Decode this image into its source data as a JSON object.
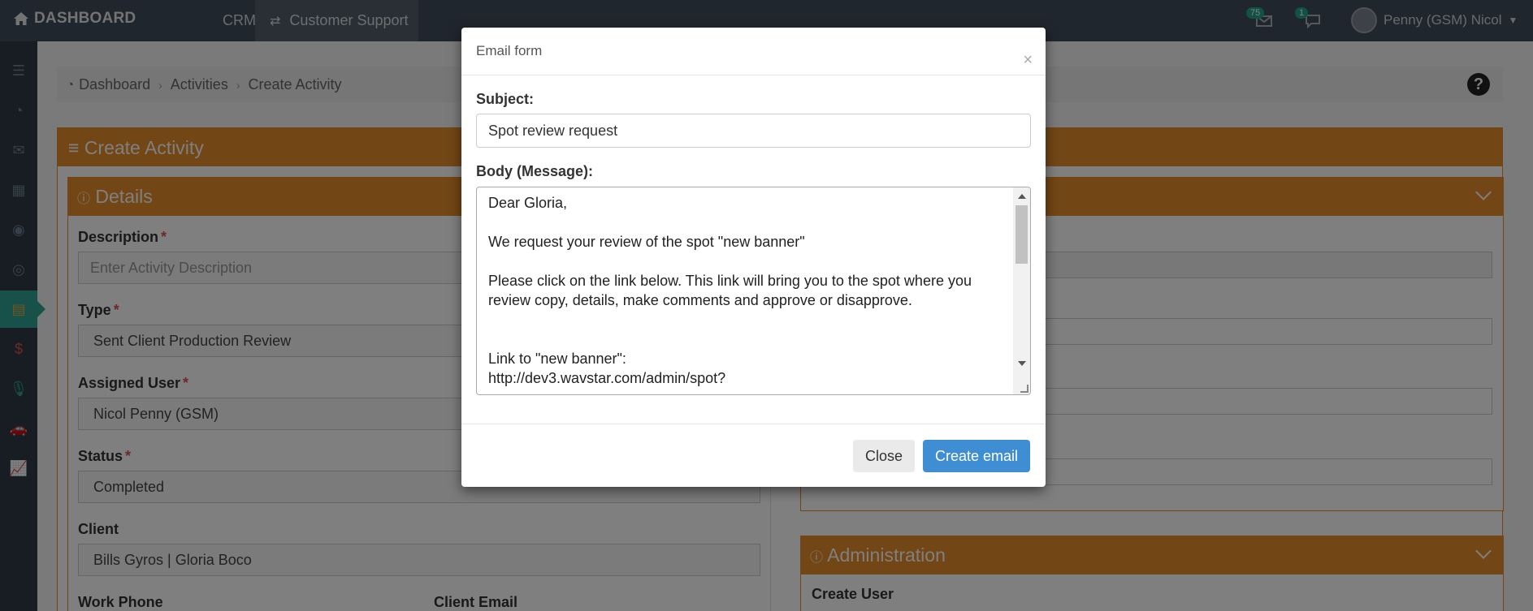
{
  "topbar": {
    "brand": "DASHBOARD",
    "crm": "CRM",
    "customer_support": "Customer Support",
    "mail_badge": "75",
    "chat_badge": "1",
    "user_name": "Penny (GSM) Nicol"
  },
  "breadcrumb": [
    "Dashboard",
    "Activities",
    "Create Activity"
  ],
  "main": {
    "title": "Create Activity",
    "details_title": "Details",
    "admin_title": "Administration",
    "create_user_label": "Create User",
    "fields": {
      "description_label": "Description",
      "description_placeholder": "Enter Activity Description",
      "type_label": "Type",
      "type_value": "Sent Client Production Review",
      "assigned_label": "Assigned User",
      "assigned_value": "Nicol Penny (GSM)",
      "status_label": "Status",
      "status_value": "Completed",
      "client_label": "Client",
      "client_value": "Bills Gyros | Gloria Boco",
      "work_phone_label": "Work Phone",
      "client_email_label": "Client Email"
    }
  },
  "modal": {
    "title": "Email form",
    "subject_label": "Subject:",
    "subject_value": "Spot review request",
    "body_label": "Body (Message):",
    "body_value": "Dear Gloria,\n\nWe request your review of the spot \"new banner\"\n\nPlease click on the link below. This link will bring you to the spot where you review copy, details, make comments and approve or disapprove.\n\n\nLink to \"new banner\":\nhttp://dev3.wavstar.com/admin/spot?\n",
    "close_label": "Close",
    "create_label": "Create email"
  }
}
